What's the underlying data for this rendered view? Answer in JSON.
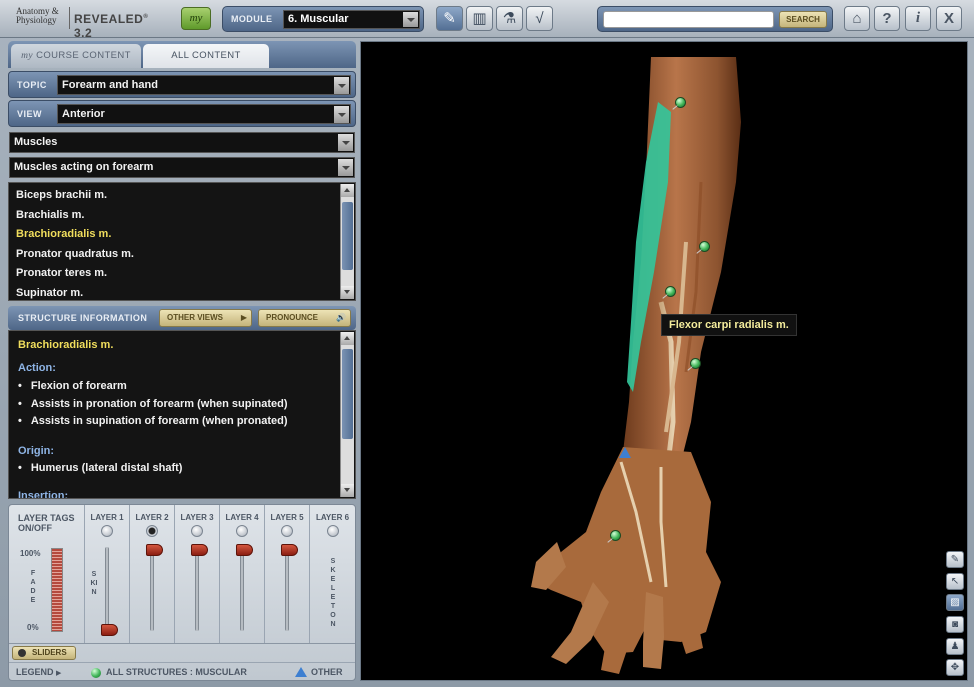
{
  "topbar": {
    "logo_small": "Anatomy & Physiology",
    "logo_main": "REVEALED",
    "logo_version": "3.2",
    "my_button": "my",
    "module_label": "MODULE",
    "module_value": "6. Muscular",
    "search_placeholder": "",
    "search_button": "SEARCH",
    "nav": [
      "⌂",
      "?",
      "i",
      "X"
    ]
  },
  "tabs": {
    "my_prefix": "my",
    "my_label": "COURSE CONTENT",
    "all_label": "ALL CONTENT"
  },
  "topic": {
    "label": "TOPIC",
    "value": "Forearm and hand"
  },
  "view": {
    "label": "VIEW",
    "value": "Anterior"
  },
  "filter1": "Muscles",
  "filter2": "Muscles acting on forearm",
  "structure_list": [
    "Biceps brachii m.",
    "Brachialis m.",
    "Brachioradialis m.",
    "Pronator quadratus m.",
    "Pronator teres m.",
    "Supinator m."
  ],
  "selected_structure_index": 2,
  "info_bar": {
    "label": "STRUCTURE INFORMATION",
    "other_views": "OTHER VIEWS",
    "pronounce": "PRONOUNCE"
  },
  "info": {
    "name": "Brachioradialis m.",
    "action_heading": "Action:",
    "actions": [
      "Flexion of forearm",
      "Assists in pronation of forearm (when supinated)",
      "Assists in supination of forearm (when pronated)"
    ],
    "origin_heading": "Origin:",
    "origins": [
      "Humerus (lateral distal shaft)"
    ],
    "insertion_heading": "Insertion:"
  },
  "layers": {
    "tags_label": "LAYER TAGS ON/OFF",
    "columns": [
      "LAYER 1",
      "LAYER 2",
      "LAYER 3",
      "LAYER 4",
      "LAYER 5",
      "LAYER 6"
    ],
    "active_layer": 2,
    "fade_top": "100%",
    "fade_bottom": "0%",
    "fade_label": "FADE",
    "layer1_label": "SKIN",
    "layer6_label": "SKELETON",
    "sliders_button": "SLIDERS"
  },
  "legend": {
    "label": "LEGEND",
    "all_structures": "ALL STRUCTURES : MUSCULAR",
    "other": "OTHER"
  },
  "viewer": {
    "tooltip": "Flexor carpi radialis m."
  },
  "colors": {
    "accent": "#536f94",
    "highlight_text": "#f1de5d",
    "structure_pin": "#3fb457",
    "other_marker": "#3d7fd1",
    "highlighted_muscle": "#34c49a"
  }
}
